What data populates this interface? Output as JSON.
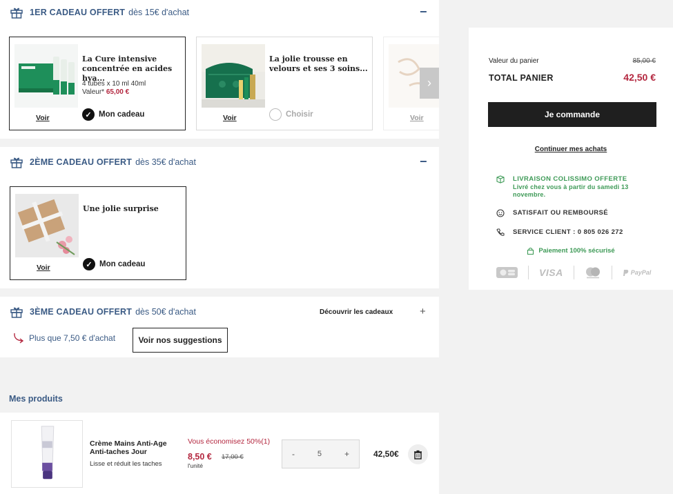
{
  "gift1": {
    "strong": "1ER CADEAU OFFERT",
    "light": "dès 15€ d'achat",
    "toggle": "−",
    "cards": [
      {
        "title": "La Cure intensive concentrée en acides hya...",
        "sub": "4 tubes x 10 ml 40ml",
        "price_label": "Valeur*",
        "price": "65,00 €",
        "voir": "Voir",
        "choice": "Mon cadeau"
      },
      {
        "title": "La jolie trousse en velours et ses 3 soins...",
        "voir": "Voir",
        "choice": "Choisir"
      },
      {
        "voir": "Voir"
      }
    ],
    "next": "›"
  },
  "gift2": {
    "strong": "2ÈME CADEAU OFFERT",
    "light": "dès 35€ d'achat",
    "toggle": "−",
    "card": {
      "title": "Une jolie surprise",
      "voir": "Voir",
      "choice": "Mon cadeau"
    }
  },
  "gift3": {
    "strong": "3ÈME CADEAU OFFERT",
    "light": "dès 50€ d'achat",
    "discover": "Découvrir les cadeaux",
    "toggle": "+",
    "hint": "Plus que 7,50 € d'achat",
    "suggest": "Voir nos suggestions"
  },
  "products": {
    "title": "Mes produits",
    "item": {
      "name": "Crème Mains Anti-Age Anti-taches Jour",
      "desc": "Lisse et réduit les taches",
      "saving": "Vous économisez 50%(1)",
      "price": "8,50 €",
      "old_price": "17,00 €",
      "unit": "l'unité",
      "qty_minus": "-",
      "qty": "5",
      "qty_plus": "+",
      "total": "42,50€"
    }
  },
  "summary": {
    "value_label": "Valeur du panier",
    "value_old": "85,00 €",
    "total_label": "TOTAL PANIER",
    "total_value": "42,50 €",
    "cta": "Je commande",
    "continue": "Continuer mes achats",
    "delivery_title": "LIVRAISON COLISSIMO OFFERTE",
    "delivery_sub": "Livré chez vous à partir du samedi 13 novembre.",
    "satisfied": "SATISFAIT OU REMBOURSÉ",
    "service": "SERVICE CLIENT : 0 805 026 272",
    "secure": "Paiement 100% sécurisé",
    "payments": {
      "visa": "VISA",
      "paypal": "PayPal"
    }
  },
  "colors": {
    "accent_blue": "#3a5a84",
    "price_red": "#b3263e",
    "green": "#3e9a57",
    "cta_bg": "#1f1f1f"
  }
}
